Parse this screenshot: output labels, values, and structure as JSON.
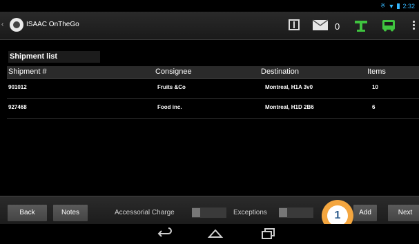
{
  "status_bar": {
    "time": "2:32"
  },
  "action_bar": {
    "app_title": "ISAAC OnTheGo",
    "mail_count": "0",
    "icons": [
      "back-chevron-icon",
      "app-logo-icon",
      "grid-icon",
      "mail-icon",
      "plug-icon",
      "bus-icon",
      "overflow-menu-icon"
    ]
  },
  "shipment_list": {
    "title": "Shipment list",
    "columns": [
      "Shipment #",
      "Consignee",
      "Destination",
      "Items"
    ],
    "rows": [
      {
        "shipment": "901012",
        "consignee": "Fruits &Co",
        "destination": "Montreal, H1A 3v0",
        "items": "10"
      },
      {
        "shipment": "927468",
        "consignee": "Food inc.",
        "destination": "Montreal, H1D 2B6",
        "items": "6"
      }
    ]
  },
  "bottom_bar": {
    "back_label": "Back",
    "notes_label": "Notes",
    "accessorial_label": "Accessorial Charge",
    "exceptions_label": "Exceptions",
    "add_label": "Add",
    "next_label": "Next",
    "callout_number": "1"
  },
  "nav_bar": {
    "icons": [
      "back-nav-icon",
      "home-nav-icon",
      "recents-nav-icon"
    ]
  },
  "colors": {
    "accent": "#35b8ff",
    "green": "#3fc43f",
    "callout": "#f4a63f",
    "callout_text": "#2d5c8c"
  }
}
